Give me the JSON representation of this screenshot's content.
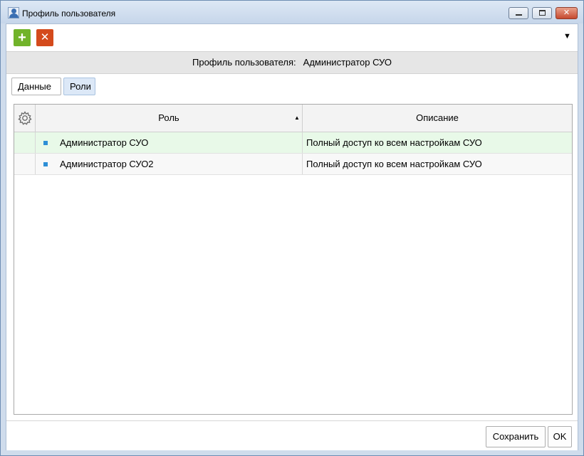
{
  "window": {
    "title": "Профиль пользователя",
    "icon": "user-icon",
    "controls": {
      "minimize": "minimize-icon",
      "maximize": "maximize-icon",
      "close": "close-icon"
    }
  },
  "toolbar": {
    "add_icon": "plus-icon",
    "delete_icon": "x-icon",
    "menu_icon": "dropdown-arrow-icon",
    "add_glyph": "+",
    "delete_glyph": "✕",
    "menu_glyph": "▼"
  },
  "profile_header": {
    "label": "Профиль пользователя:",
    "value": "Администратор СУО"
  },
  "tabs": [
    {
      "label": "Данные",
      "selected": false
    },
    {
      "label": "Роли",
      "selected": true
    }
  ],
  "grid": {
    "settings_icon": "gear-icon",
    "columns": [
      {
        "label": "Роль",
        "sort": "ascending",
        "sort_glyph": "▲"
      },
      {
        "label": "Описание"
      }
    ],
    "rows": [
      {
        "role": "Администратор СУО",
        "description": "Полный доступ ко всем настройкам СУО",
        "highlighted": true
      },
      {
        "role": "Администратор СУО2",
        "description": "Полный доступ ко всем настройкам СУО",
        "highlighted": false
      }
    ]
  },
  "footer": {
    "save_label": "Сохранить",
    "ok_label": "OK"
  },
  "colors": {
    "add_button": "#71b32a",
    "delete_button": "#d44a1c",
    "selected_row": "#e8f9e8",
    "selected_tab": "#dce8f7",
    "row_bullet": "#2d8fd6"
  }
}
